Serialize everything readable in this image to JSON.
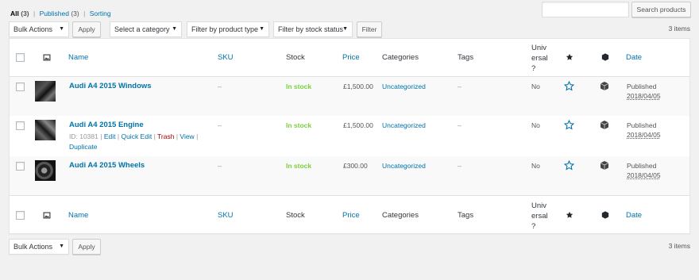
{
  "filters_nav": {
    "all_label": "All",
    "all_count": "(3)",
    "published_label": "Published",
    "published_count": "(3)",
    "sorting_label": "Sorting",
    "separator": "|"
  },
  "search": {
    "placeholder": "",
    "value": "",
    "button_label": "Search products"
  },
  "top_nav": {
    "bulk_actions": "Bulk Actions",
    "apply_label": "Apply",
    "category_select": "Select a category",
    "product_type_select": "Filter by product type",
    "stock_status_select": "Filter by stock status",
    "filter_label": "Filter",
    "items_count": "3 items"
  },
  "columns": {
    "name": "Name",
    "sku": "SKU",
    "stock": "Stock",
    "price": "Price",
    "categories": "Categories",
    "tags": "Tags",
    "universal": [
      "Univ",
      "ersal",
      "?"
    ],
    "date": "Date"
  },
  "products": [
    {
      "name": "Audi A4 2015 Windows",
      "sku": "–",
      "stock": "In stock",
      "price": "£1,500.00",
      "category": "Uncategorized",
      "tags": "–",
      "universal": "No",
      "status": "Published",
      "date": "2018/04/05"
    },
    {
      "name": "Audi A4 2015 Engine",
      "sku": "–",
      "stock": "In stock",
      "price": "£1,500.00",
      "category": "Uncategorized",
      "tags": "–",
      "universal": "No",
      "status": "Published",
      "date": "2018/04/05",
      "row_actions": {
        "id": "ID: 10381",
        "edit": "Edit",
        "quick_edit": "Quick Edit",
        "trash": "Trash",
        "view": "View",
        "duplicate": "Duplicate",
        "sep": "|"
      }
    },
    {
      "name": "Audi A4 2015 Wheels",
      "sku": "–",
      "stock": "In stock",
      "price": "£300.00",
      "category": "Uncategorized",
      "tags": "–",
      "universal": "No",
      "status": "Published",
      "date": "2018/04/05"
    }
  ],
  "bottom_nav": {
    "bulk_actions": "Bulk Actions",
    "apply_label": "Apply",
    "items_count": "3 items"
  },
  "icons": {
    "thumbnail_header": "image-icon",
    "featured_header": "star-filled-icon",
    "featured_row": "star-outline-icon",
    "type_header": "cube-icon",
    "type_row": "cube-icon",
    "dropdown": "caret-down-icon"
  },
  "colors": {
    "link": "#0073aa",
    "in_stock": "#7ad03a",
    "trash": "#a00",
    "background": "#f1f1f1"
  }
}
